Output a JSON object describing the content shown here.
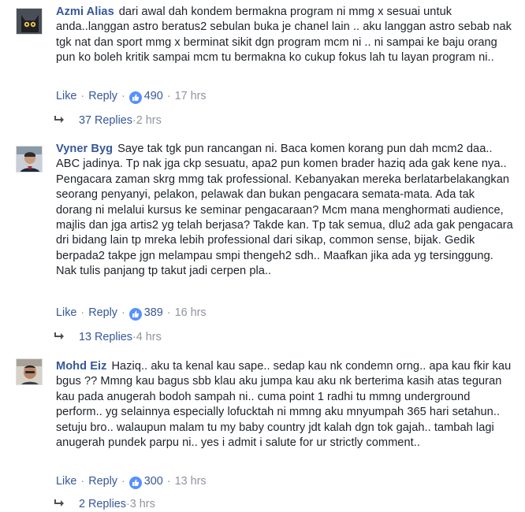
{
  "comments": [
    {
      "author": "Azmi Alias",
      "text": "dari awal dah kondem bermakna program ni mmg x sesuai untuk anda..langgan astro beratus2 sebulan buka je chanel lain .. aku langgan astro sebab nak tgk nat dan sport mmg x berminat sikit dgn program mcm ni .. ni sampai ke baju orang pun ko boleh kritik sampai mcm tu bermakna ko cukup fokus lah tu layan program ni..",
      "like_label": "Like",
      "reply_label": "Reply",
      "like_count": "490",
      "time": "17 hrs",
      "replies_label": "37 Replies",
      "replies_time": "2 hrs"
    },
    {
      "author": "Vyner Byg",
      "text": "Saye tak tgk pun rancangan ni. Baca komen korang pun dah mcm2 daa.. ABC jadinya. Tp nak jga ckp sesuatu, apa2 pun komen brader haziq ada gak kene nya.. Pengacara zaman skrg mmg tak professional. Kebanyakan mereka berlatarbelakangkan seorang penyanyi, pelakon, pelawak dan bukan pengacara semata-mata. Ada tak dorang ni melalui kursus ke seminar pengacaraan? Mcm mana menghormati audience, majlis dan jga artis2 yg telah berjasa? Takde kan. Tp tak semua, dlu2 ada gak pengacara dri bidang lain tp mreka lebih professional dari sikap, common sense, bijak. Gedik berpada2 takpe jgn melampau smpi thengeh2 sdh.. Maafkan jika ada yg tersinggung. Nak tulis panjang tp takut jadi cerpen pla..",
      "like_label": "Like",
      "reply_label": "Reply",
      "like_count": "389",
      "time": "16 hrs",
      "replies_label": "13 Replies",
      "replies_time": "4 hrs"
    },
    {
      "author": "Mohd Eiz",
      "text": "Haziq.. aku ta kenal kau sape.. sedap kau nk condemn orng.. apa kau fkir kau bgus ?? Mmng kau bagus sbb klau aku jumpa kau aku nk berterima kasih atas teguran kau pada anugerah bodoh sampah ni.. cuma point 1 radhi tu mmng underground perform.. yg selainnya especially lofucktah ni mmng aku mnyumpah 365 hari setahun.. setuju bro.. walaupun malam tu my baby country jdt kalah dgn tok gajah.. tambah lagi anugerah pundek parpu ni.. yes i admit i salute for ur strictly comment..",
      "like_label": "Like",
      "reply_label": "Reply",
      "like_count": "300",
      "time": "13 hrs",
      "replies_label": "2 Replies",
      "replies_time": "3 hrs"
    }
  ],
  "colors": {
    "link": "#365899",
    "meta": "#90949c",
    "text": "#1d2129",
    "like_badge": "#5890ff"
  },
  "icons": [
    "cat-avatar",
    "man-avatar",
    "selfie-avatar",
    "thumbs-up-icon",
    "reply-arrow-icon"
  ]
}
